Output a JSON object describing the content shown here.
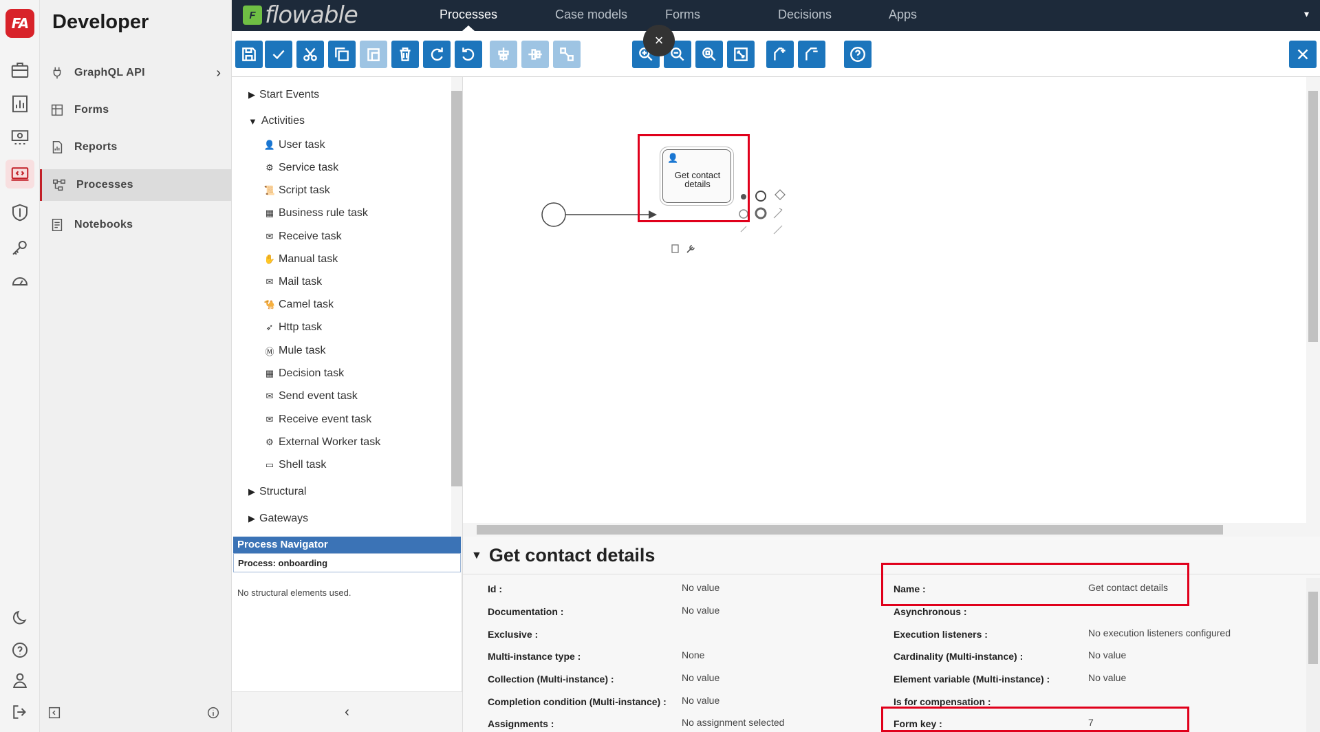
{
  "rail": {
    "logo_text": "FA",
    "icons": [
      "briefcase-icon",
      "dashboard-icon",
      "money-icon",
      "developer-icon",
      "shield-icon",
      "key-icon",
      "gauge-icon",
      "moon-icon",
      "help-icon",
      "user-icon",
      "logout-icon"
    ]
  },
  "devside": {
    "title": "Developer",
    "items": [
      {
        "label": "GraphQL API",
        "icon": "plug-icon"
      },
      {
        "label": "Forms",
        "icon": "table-icon"
      },
      {
        "label": "Reports",
        "icon": "report-icon"
      },
      {
        "label": "Processes",
        "icon": "process-icon"
      },
      {
        "label": "Notebooks",
        "icon": "notebook-icon"
      }
    ]
  },
  "topbar": {
    "logo": "flowable",
    "tabs": [
      "Processes",
      "Case models",
      "Forms",
      "Decisions",
      "Apps"
    ],
    "active_tab": "Processes",
    "dropdown": "▾"
  },
  "toolbar": {
    "buttons": [
      "save-icon",
      "validate-icon",
      "cut-icon",
      "copy-icon",
      "paste-icon",
      "delete-icon",
      "redo-icon",
      "undo-icon",
      "align-horizontal-icon",
      "align-vertical-icon",
      "same-size-icon",
      "zoom-in-icon",
      "zoom-out-icon",
      "zoom-actual-icon",
      "zoom-fit-icon",
      "add-bendpoint-icon",
      "remove-bendpoint-icon",
      "help-icon"
    ],
    "close_float": "×",
    "close_editor": "✕",
    "accent": "#1c75bc"
  },
  "palette": {
    "groups": [
      {
        "label": "Start Events",
        "expanded": false
      },
      {
        "label": "Activities",
        "expanded": true
      },
      {
        "label": "Structural",
        "expanded": false
      },
      {
        "label": "Gateways",
        "expanded": false
      }
    ],
    "activities": [
      {
        "label": "User task",
        "icon": "👤"
      },
      {
        "label": "Service task",
        "icon": "⚙"
      },
      {
        "label": "Script task",
        "icon": "📜"
      },
      {
        "label": "Business rule task",
        "icon": "▦"
      },
      {
        "label": "Receive task",
        "icon": "✉"
      },
      {
        "label": "Manual task",
        "icon": "✋"
      },
      {
        "label": "Mail task",
        "icon": "✉"
      },
      {
        "label": "Camel task",
        "icon": "🐪"
      },
      {
        "label": "Http task",
        "icon": "➶"
      },
      {
        "label": "Mule task",
        "icon": "Ⓜ"
      },
      {
        "label": "Decision task",
        "icon": "▦"
      },
      {
        "label": "Send event task",
        "icon": "✉"
      },
      {
        "label": "Receive event task",
        "icon": "✉"
      },
      {
        "label": "External Worker task",
        "icon": "⚙"
      },
      {
        "label": "Shell task",
        "icon": "▭"
      }
    ]
  },
  "navigator": {
    "header": "Process Navigator",
    "process": "Process: onboarding",
    "empty": "No structural elements used.",
    "collapse": "‹"
  },
  "canvas": {
    "task_name_line1": "Get contact",
    "task_name_line2": "details"
  },
  "properties": {
    "title": "Get contact details",
    "left": [
      {
        "label": "Id :",
        "value": "No value"
      },
      {
        "label": "Documentation :",
        "value": "No value"
      },
      {
        "label": "Exclusive :",
        "value": ""
      },
      {
        "label": "Multi-instance type :",
        "value": "None"
      },
      {
        "label": "Collection (Multi-instance) :",
        "value": "No value"
      },
      {
        "label": "Completion condition (Multi-instance) :",
        "value": "No value"
      },
      {
        "label": "Assignments :",
        "value": "No assignment selected"
      }
    ],
    "right": [
      {
        "label": "Name :",
        "value": "Get contact details"
      },
      {
        "label": "Asynchronous :",
        "value": ""
      },
      {
        "label": "Execution listeners :",
        "value": "No execution listeners configured"
      },
      {
        "label": "Cardinality (Multi-instance) :",
        "value": "No value"
      },
      {
        "label": "Element variable (Multi-instance) :",
        "value": "No value"
      },
      {
        "label": "Is for compensation :",
        "value": ""
      },
      {
        "label": "Form key :",
        "value": "7"
      }
    ]
  },
  "colors": {
    "brand_red": "#d8232a",
    "header_bg": "#1d2a3a",
    "highlight": "#e0001b",
    "navigator": "#3b73b6"
  }
}
